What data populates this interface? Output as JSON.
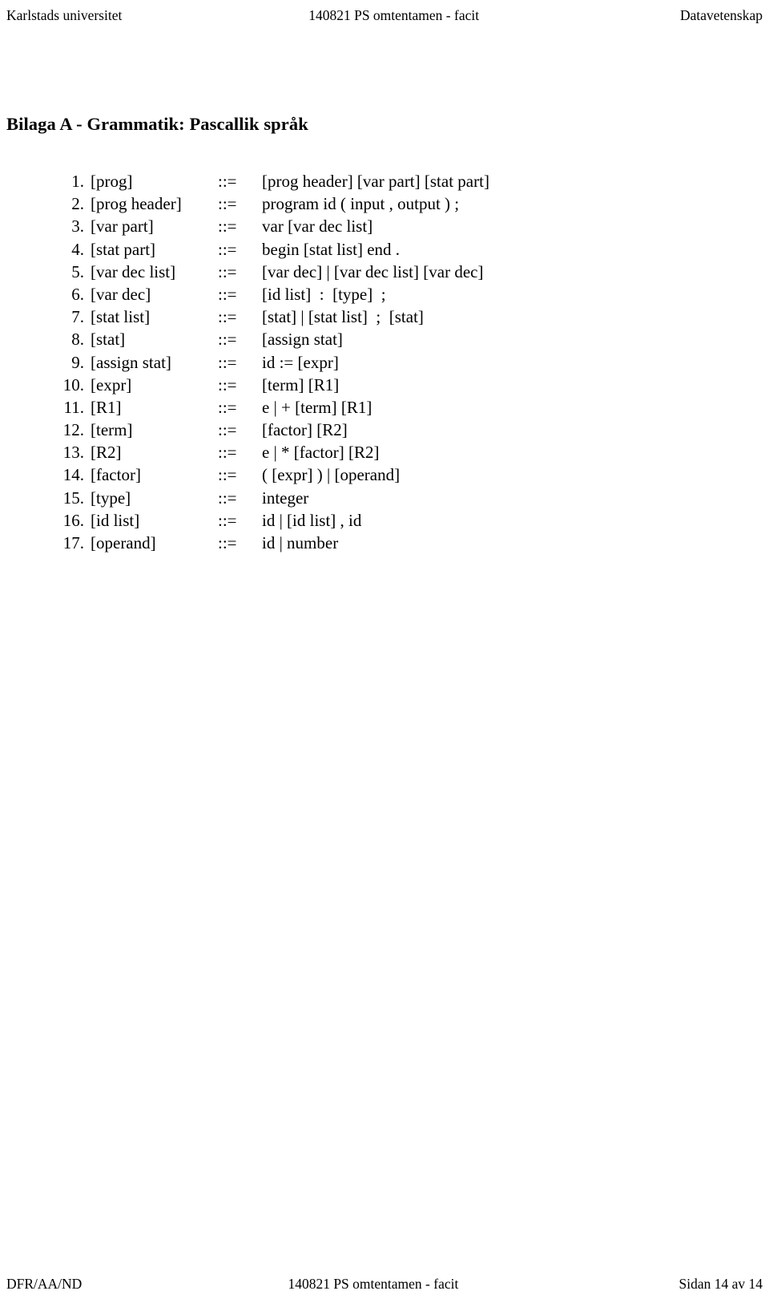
{
  "header": {
    "left": "Karlstads universitet",
    "center": "140821 PS omtentamen - facit",
    "right": "Datavetenskap"
  },
  "title": "Bilaga A - Grammatik: Pascallik språk",
  "grammar": {
    "arrow_symbol": "::=",
    "rules": [
      {
        "num": "1.",
        "lhs": "[prog]",
        "arrow": "::=",
        "rhs": "[prog header] [var part] [stat part]"
      },
      {
        "num": "2.",
        "lhs": "[prog header]",
        "arrow": "::=",
        "rhs": "program id ( input , output ) ;"
      },
      {
        "num": "3.",
        "lhs": "[var part]",
        "arrow": "::=",
        "rhs": "var [var dec list]"
      },
      {
        "num": "4.",
        "lhs": "[stat part]",
        "arrow": "::=",
        "rhs": "begin [stat list] end ."
      },
      {
        "num": "5.",
        "lhs": "[var dec list]",
        "arrow": "::=",
        "rhs": "[var dec] | [var dec list] [var dec]"
      },
      {
        "num": "6.",
        "lhs": "[var dec]",
        "arrow": "::=",
        "rhs": "[id list]  :  [type]  ;"
      },
      {
        "num": "7.",
        "lhs": "[stat list]",
        "arrow": "::=",
        "rhs": "[stat] | [stat list]  ;  [stat]"
      },
      {
        "num": "8.",
        "lhs": "[stat]",
        "arrow": "::=",
        "rhs": "[assign stat]"
      },
      {
        "num": "9.",
        "lhs": "[assign stat]",
        "arrow": "::=",
        "rhs": "id := [expr]"
      },
      {
        "num": "10.",
        "lhs": "[expr]",
        "arrow": "::=",
        "rhs": "[term] [R1]"
      },
      {
        "num": "11.",
        "lhs": "[R1]",
        "arrow": "::=",
        "rhs": "e | + [term] [R1]"
      },
      {
        "num": "12.",
        "lhs": "[term]",
        "arrow": "::=",
        "rhs": "[factor] [R2]"
      },
      {
        "num": "13.",
        "lhs": "[R2]",
        "arrow": "::=",
        "rhs": "e | * [factor] [R2]"
      },
      {
        "num": "14.",
        "lhs": "[factor]",
        "arrow": "::=",
        "rhs": "( [expr] ) | [operand]"
      },
      {
        "num": "15.",
        "lhs": "[type]",
        "arrow": "::=",
        "rhs": "integer"
      },
      {
        "num": "16.",
        "lhs": "[id list]",
        "arrow": "::=",
        "rhs": "id | [id list] , id"
      },
      {
        "num": "17.",
        "lhs": "[operand]",
        "arrow": "::=",
        "rhs": "id | number"
      }
    ]
  },
  "footer": {
    "left": "DFR/AA/ND",
    "center": "140821 PS omtentamen - facit",
    "right": "Sidan 14 av 14"
  }
}
